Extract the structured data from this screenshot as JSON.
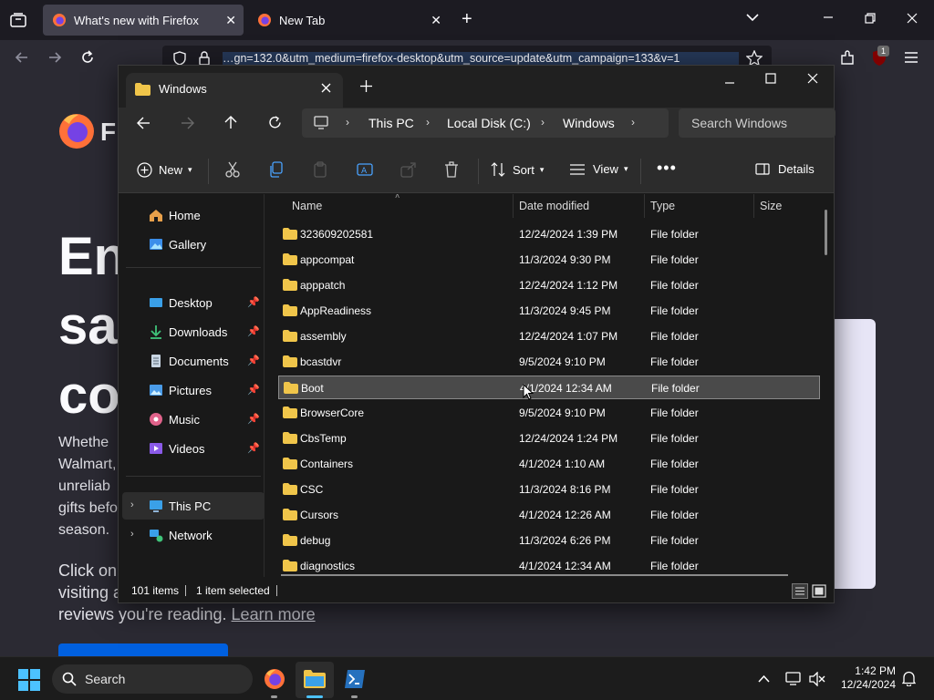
{
  "firefox": {
    "tabs": [
      {
        "title": "What's new with Firefox"
      },
      {
        "title": "New Tab"
      }
    ],
    "url": "…gn=132.0&utm_medium=firefox-desktop&utm_source=update&utm_campaign=133&v=1",
    "notification_count": "1",
    "page": {
      "logo_text": "Fi",
      "hero_lines": [
        "En",
        "sa",
        "co"
      ],
      "body_lines": [
        "Whethe",
        "Walmart,",
        "unreliab",
        "gifts befo",
        "season."
      ],
      "body2_lines": [
        "Click on",
        "visiting a"
      ],
      "body2_last_prefix": "reviews you're reading.",
      "link_text": "Learn more"
    }
  },
  "explorer": {
    "tab_title": "Windows",
    "breadcrumb": [
      "This PC",
      "Local Disk (C:)",
      "Windows"
    ],
    "search_placeholder": "Search Windows",
    "toolbar": {
      "new_label": "New",
      "sort_label": "Sort",
      "view_label": "View",
      "details_label": "Details"
    },
    "sidebar": {
      "home": "Home",
      "gallery": "Gallery",
      "desktop": "Desktop",
      "downloads": "Downloads",
      "documents": "Documents",
      "pictures": "Pictures",
      "music": "Music",
      "videos": "Videos",
      "this_pc": "This PC",
      "network": "Network"
    },
    "columns": {
      "name": "Name",
      "date": "Date modified",
      "type": "Type",
      "size": "Size"
    },
    "files": [
      {
        "name": "323609202581",
        "date": "12/24/2024 1:39 PM",
        "type": "File folder"
      },
      {
        "name": "appcompat",
        "date": "11/3/2024 9:30 PM",
        "type": "File folder"
      },
      {
        "name": "apppatch",
        "date": "12/24/2024 1:12 PM",
        "type": "File folder"
      },
      {
        "name": "AppReadiness",
        "date": "11/3/2024 9:45 PM",
        "type": "File folder"
      },
      {
        "name": "assembly",
        "date": "12/24/2024 1:07 PM",
        "type": "File folder"
      },
      {
        "name": "bcastdvr",
        "date": "9/5/2024 9:10 PM",
        "type": "File folder"
      },
      {
        "name": "Boot",
        "date": "4/1/2024 12:34 AM",
        "type": "File folder"
      },
      {
        "name": "BrowserCore",
        "date": "9/5/2024 9:10 PM",
        "type": "File folder"
      },
      {
        "name": "CbsTemp",
        "date": "12/24/2024 1:24 PM",
        "type": "File folder"
      },
      {
        "name": "Containers",
        "date": "4/1/2024 1:10 AM",
        "type": "File folder"
      },
      {
        "name": "CSC",
        "date": "11/3/2024 8:16 PM",
        "type": "File folder"
      },
      {
        "name": "Cursors",
        "date": "4/1/2024 12:26 AM",
        "type": "File folder"
      },
      {
        "name": "debug",
        "date": "11/3/2024 6:26 PM",
        "type": "File folder"
      },
      {
        "name": "diagnostics",
        "date": "4/1/2024 12:34 AM",
        "type": "File folder"
      }
    ],
    "status": {
      "count": "101 items",
      "selected": "1 item selected"
    }
  },
  "taskbar": {
    "search_placeholder": "Search",
    "time": "1:42 PM",
    "date": "12/24/2024"
  },
  "colors": {
    "folder": "#f0c54a",
    "accent_blue": "#0060df",
    "selection": "#4a4a4a"
  }
}
